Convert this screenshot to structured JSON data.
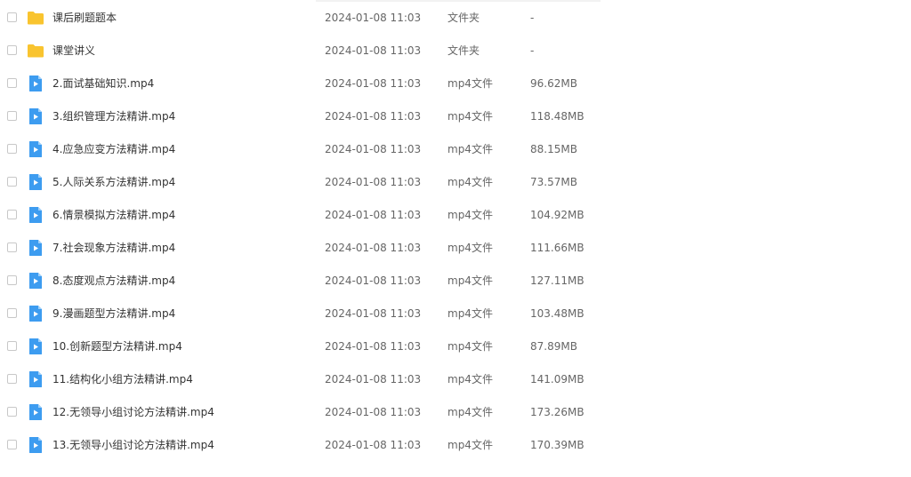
{
  "files": [
    {
      "name": "课后刷题题本",
      "date": "2024-01-08 11:03",
      "type": "文件夹",
      "size": "-",
      "icon": "folder-icon"
    },
    {
      "name": "课堂讲义",
      "date": "2024-01-08 11:03",
      "type": "文件夹",
      "size": "-",
      "icon": "folder-icon"
    },
    {
      "name": "2.面试基础知识.mp4",
      "date": "2024-01-08 11:03",
      "type": "mp4文件",
      "size": "96.62MB",
      "icon": "video-file-icon"
    },
    {
      "name": "3.组织管理方法精讲.mp4",
      "date": "2024-01-08 11:03",
      "type": "mp4文件",
      "size": "118.48MB",
      "icon": "video-file-icon"
    },
    {
      "name": "4.应急应变方法精讲.mp4",
      "date": "2024-01-08 11:03",
      "type": "mp4文件",
      "size": "88.15MB",
      "icon": "video-file-icon"
    },
    {
      "name": "5.人际关系方法精讲.mp4",
      "date": "2024-01-08 11:03",
      "type": "mp4文件",
      "size": "73.57MB",
      "icon": "video-file-icon"
    },
    {
      "name": "6.情景模拟方法精讲.mp4",
      "date": "2024-01-08 11:03",
      "type": "mp4文件",
      "size": "104.92MB",
      "icon": "video-file-icon"
    },
    {
      "name": "7.社会现象方法精讲.mp4",
      "date": "2024-01-08 11:03",
      "type": "mp4文件",
      "size": "111.66MB",
      "icon": "video-file-icon"
    },
    {
      "name": "8.态度观点方法精讲.mp4",
      "date": "2024-01-08 11:03",
      "type": "mp4文件",
      "size": "127.11MB",
      "icon": "video-file-icon"
    },
    {
      "name": "9.漫画题型方法精讲.mp4",
      "date": "2024-01-08 11:03",
      "type": "mp4文件",
      "size": "103.48MB",
      "icon": "video-file-icon"
    },
    {
      "name": "10.创新题型方法精讲.mp4",
      "date": "2024-01-08 11:03",
      "type": "mp4文件",
      "size": "87.89MB",
      "icon": "video-file-icon"
    },
    {
      "name": "11.结构化小组方法精讲.mp4",
      "date": "2024-01-08 11:03",
      "type": "mp4文件",
      "size": "141.09MB",
      "icon": "video-file-icon"
    },
    {
      "name": "12.无领导小组讨论方法精讲.mp4",
      "date": "2024-01-08 11:03",
      "type": "mp4文件",
      "size": "173.26MB",
      "icon": "video-file-icon"
    },
    {
      "name": "13.无领导小组讨论方法精讲.mp4",
      "date": "2024-01-08 11:03",
      "type": "mp4文件",
      "size": "170.39MB",
      "icon": "video-file-icon"
    }
  ],
  "colors": {
    "folder": "#f9c42f",
    "video": "#3d9cf0"
  }
}
